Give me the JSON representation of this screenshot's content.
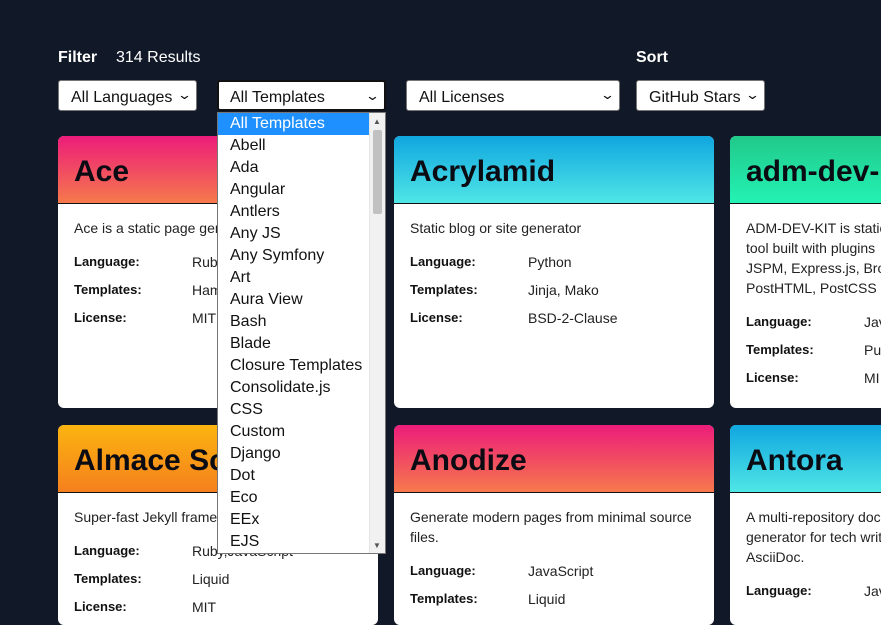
{
  "filter": {
    "label": "Filter",
    "results": "314 Results"
  },
  "sort": {
    "label": "Sort"
  },
  "selects": {
    "language": "All Languages",
    "templates": "All Templates",
    "licenses": "All Licenses",
    "sort": "GitHub Stars"
  },
  "dropdown": {
    "options": [
      "All Templates",
      "Abell",
      "Ada",
      "Angular",
      "Antlers",
      "Any JS",
      "Any Symfony",
      "Art",
      "Aura View",
      "Bash",
      "Blade",
      "Closure Templates",
      "Consolidate.js",
      "CSS",
      "Custom",
      "Django",
      "Dot",
      "Eco",
      "EEx",
      "EJS"
    ],
    "selected_index": 0
  },
  "labels": {
    "language": "Language:",
    "templates": "Templates:",
    "license": "License:"
  },
  "cards": [
    {
      "title": "Ace",
      "desc": "Ace is a static page gen",
      "language": "Rub",
      "templates": "Ham",
      "license": "MIT",
      "gradient": "#ec1c7a"
    },
    {
      "title": "Acrylamid",
      "desc": "Static blog or site generator",
      "language": "Python",
      "templates": "Jinja, Mako",
      "license": "BSD-2-Clause",
      "gradient": "#10a6e0"
    },
    {
      "title": "adm-dev-",
      "desc": "ADM-DEV-KIT is static tool built with plugins JSPM, Express.js, Brow PostHTML, PostCSS ar",
      "language": "Jav",
      "templates": "Pu",
      "license": "MI",
      "gradient": "#21c98a"
    },
    {
      "title": "Almace Sc",
      "desc": "Super-fast Jekyll framew",
      "language": "Ruby,JavaScript",
      "templates": "Liquid",
      "license": "MIT",
      "gradient": "#fbb40f"
    },
    {
      "title": "Anodize",
      "desc": "Generate modern pages from minimal source files.",
      "language": "JavaScript",
      "templates": "Liquid",
      "license": "",
      "gradient": "#ec1c7a"
    },
    {
      "title": "Antora",
      "desc": "A multi-repository doc generator for tech writ AsciiDoc.",
      "language": "Jav",
      "templates": "",
      "license": "",
      "gradient": "#10a6e0"
    }
  ]
}
